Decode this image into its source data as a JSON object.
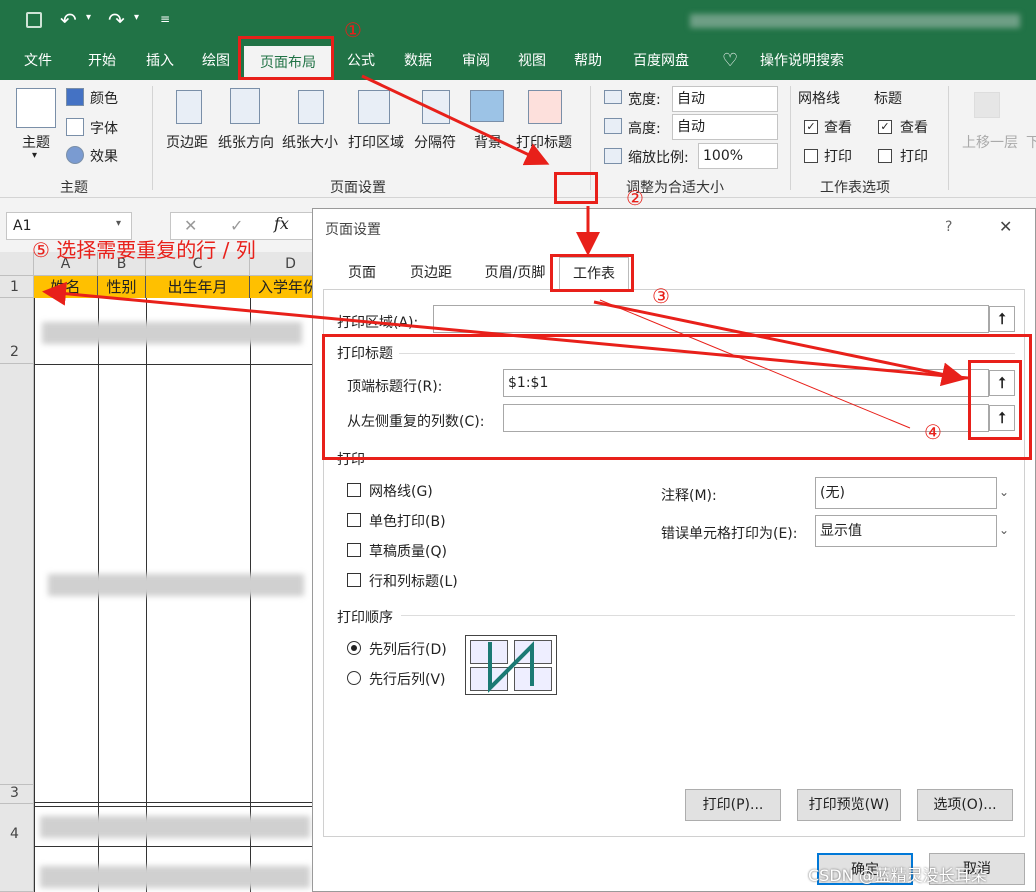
{
  "ribbon_tabs": [
    "文件",
    "开始",
    "插入",
    "绘图",
    "页面布局",
    "公式",
    "数据",
    "审阅",
    "视图",
    "帮助",
    "百度网盘"
  ],
  "active_tab": "页面布局",
  "tell_me": "操作说明搜索",
  "ribbon": {
    "theme_btn": "主题",
    "colors": "颜色",
    "fonts": "字体",
    "effects": "效果",
    "group_theme": "主题",
    "margins": "页边距",
    "orientation": "纸张方向",
    "size": "纸张大小",
    "print_area": "打印区域",
    "breaks": "分隔符",
    "background": "背景",
    "print_titles": "打印标题",
    "group_page_setup": "页面设置",
    "width_label": "宽度:",
    "width_value": "自动",
    "height_label": "高度:",
    "height_value": "自动",
    "scale_label": "缩放比例:",
    "scale_value": "100%",
    "group_scale": "调整为合适大小",
    "gridlines": "网格线",
    "headings": "标题",
    "view": "查看",
    "print": "打印",
    "group_sheet_options": "工作表选项",
    "bring_forward": "上移一层",
    "bring_forward_tail": "下"
  },
  "namebox": "A1",
  "fx": "fx",
  "sheet": {
    "columns": [
      "A",
      "B",
      "C",
      "D"
    ],
    "headers": [
      "姓名",
      "性别",
      "出生年月",
      "入学年份"
    ],
    "rows": [
      "1",
      "2",
      "3",
      "4"
    ]
  },
  "dialog": {
    "title": "页面设置",
    "help": "?",
    "close": "✕",
    "tabs": [
      "页面",
      "页边距",
      "页眉/页脚",
      "工作表"
    ],
    "active_tab": "工作表",
    "print_area_label": "打印区域(A):",
    "print_titles_section": "打印标题",
    "rows_repeat_label": "顶端标题行(R):",
    "rows_repeat_value": "$1:$1",
    "cols_repeat_label": "从左侧重复的列数(C):",
    "cols_repeat_value": "",
    "print_section": "打印",
    "gridlines": "网格线(G)",
    "black_white": "单色打印(B)",
    "draft": "草稿质量(Q)",
    "row_col_headings": "行和列标题(L)",
    "comments_label": "注释(M):",
    "comments_value": "(无)",
    "errors_label": "错误单元格打印为(E):",
    "errors_value": "显示值",
    "page_order": "打印顺序",
    "down_then_over": "先列后行(D)",
    "over_then_down": "先行后列(V)",
    "print_btn": "打印(P)...",
    "preview_btn": "打印预览(W)",
    "options_btn": "选项(O)...",
    "ok_btn": "确定",
    "cancel_btn": "取消"
  },
  "annotations": {
    "n1": "①",
    "n2": "②",
    "n3": "③",
    "n4": "④",
    "n5": "⑤ 选择需要重复的行 / 列"
  },
  "watermark": "CSDN @蓝精灵没长耳朵"
}
